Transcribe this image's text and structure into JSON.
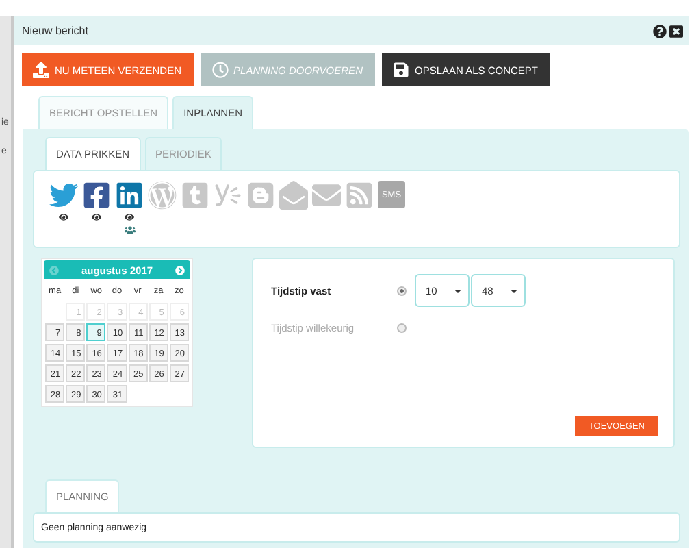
{
  "background_text": [
    "ie",
    "e"
  ],
  "window": {
    "title": "Nieuw bericht"
  },
  "actions": [
    {
      "kind": "send",
      "label": "NU METEEN VERZENDEN",
      "disabled": false
    },
    {
      "kind": "plan",
      "label": "PLANNING DOORVOEREN",
      "disabled": true
    },
    {
      "kind": "draft",
      "label": "OPSLAAN ALS CONCEPT",
      "disabled": false
    }
  ],
  "tabs": [
    {
      "label": "BERICHT OPSTELLEN",
      "selected": false
    },
    {
      "label": "INPLANNEN",
      "selected": true
    }
  ],
  "subtabs": [
    {
      "label": "DATA PRIKKEN",
      "selected": true
    },
    {
      "label": "PERIODIEK",
      "selected": false
    }
  ],
  "channels": [
    {
      "kind": "twitter",
      "active": true
    },
    {
      "kind": "facebook",
      "active": true
    },
    {
      "kind": "linkedin",
      "active": true,
      "audience": true
    },
    {
      "kind": "wordpress",
      "active": false
    },
    {
      "kind": "tumblr",
      "active": false
    },
    {
      "kind": "yammer",
      "active": false
    },
    {
      "kind": "blogger",
      "active": false
    },
    {
      "kind": "newsletter",
      "active": false
    },
    {
      "kind": "email",
      "active": false
    },
    {
      "kind": "rss",
      "active": false
    },
    {
      "kind": "sms",
      "label": "SMS",
      "active": false
    }
  ],
  "calendar": {
    "month": "augustus 2017",
    "prev_disabled": true,
    "weekdays": [
      "ma",
      "di",
      "wo",
      "do",
      "vr",
      "za",
      "zo"
    ],
    "weeks": [
      [
        {
          "day": "1",
          "muted": true,
          "selected": false
        },
        {
          "day": "2",
          "muted": true,
          "selected": false
        },
        {
          "day": "3",
          "muted": true,
          "selected": false
        },
        {
          "day": "4",
          "muted": true,
          "selected": false
        },
        {
          "day": "5",
          "muted": true,
          "selected": false
        },
        {
          "day": "6",
          "muted": true,
          "selected": false
        }
      ],
      [
        {
          "day": "7",
          "muted": false,
          "selected": false
        },
        {
          "day": "8",
          "muted": false,
          "selected": false
        },
        {
          "day": "9",
          "muted": false,
          "selected": true
        },
        {
          "day": "10",
          "muted": false,
          "selected": false
        },
        {
          "day": "11",
          "muted": false,
          "selected": false
        },
        {
          "day": "12",
          "muted": false,
          "selected": false
        },
        {
          "day": "13",
          "muted": false,
          "selected": false
        }
      ],
      [
        {
          "day": "14",
          "muted": false,
          "selected": false
        },
        {
          "day": "15",
          "muted": false,
          "selected": false
        },
        {
          "day": "16",
          "muted": false,
          "selected": false
        },
        {
          "day": "17",
          "muted": false,
          "selected": false
        },
        {
          "day": "18",
          "muted": false,
          "selected": false
        },
        {
          "day": "19",
          "muted": false,
          "selected": false
        },
        {
          "day": "20",
          "muted": false,
          "selected": false
        }
      ],
      [
        {
          "day": "21",
          "muted": false,
          "selected": false
        },
        {
          "day": "22",
          "muted": false,
          "selected": false
        },
        {
          "day": "23",
          "muted": false,
          "selected": false
        },
        {
          "day": "24",
          "muted": false,
          "selected": false
        },
        {
          "day": "25",
          "muted": false,
          "selected": false
        },
        {
          "day": "26",
          "muted": false,
          "selected": false
        },
        {
          "day": "27",
          "muted": false,
          "selected": false
        }
      ],
      [
        {
          "day": "28",
          "muted": false,
          "selected": false
        },
        {
          "day": "29",
          "muted": false,
          "selected": false
        },
        {
          "day": "30",
          "muted": false,
          "selected": false
        },
        {
          "day": "31",
          "muted": false,
          "selected": false
        }
      ]
    ]
  },
  "time_options": [
    {
      "label": "Tijdstip vast",
      "selected": true
    },
    {
      "label": "Tijdstip willekeurig",
      "selected": false
    }
  ],
  "hour": "10",
  "minute": "48",
  "add_button": "TOEVOEGEN",
  "planning": {
    "tab": "PLANNING",
    "message": "Geen planning aanwezig"
  }
}
